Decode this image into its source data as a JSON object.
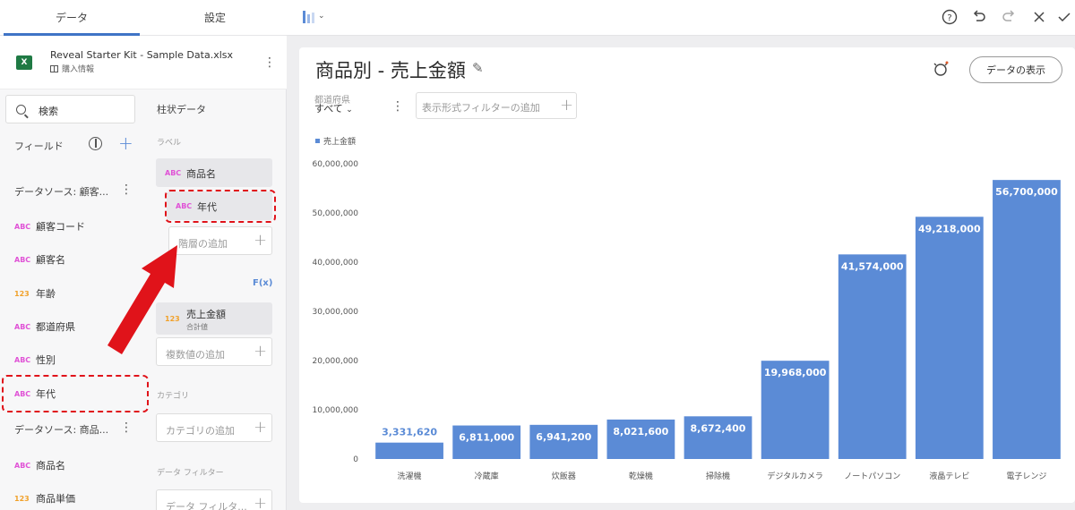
{
  "tabs": [
    "データ",
    "設定"
  ],
  "file": {
    "name": "Reveal Starter Kit - Sample Data.xlsx",
    "subtitle": "購入情報",
    "icon": "excel-icon"
  },
  "search": {
    "label": "検索"
  },
  "fields_title": "フィールド",
  "datasource1": {
    "title": "データソース: 顧客...",
    "fields": [
      {
        "type": "ABC",
        "name": "顧客コード"
      },
      {
        "type": "ABC",
        "name": "顧客名"
      },
      {
        "type": "123",
        "name": "年齢"
      },
      {
        "type": "ABC",
        "name": "都道府県"
      },
      {
        "type": "ABC",
        "name": "性別"
      },
      {
        "type": "ABC",
        "name": "年代"
      }
    ]
  },
  "datasource2": {
    "title": "データソース: 商品...",
    "fields": [
      {
        "type": "ABC",
        "name": "商品名"
      },
      {
        "type": "123",
        "name": "商品単価"
      }
    ]
  },
  "config": {
    "viz_type": "柱状データ",
    "label_section": "ラベル",
    "labels": [
      {
        "type": "ABC",
        "name": "商品名"
      },
      {
        "type": "ABC",
        "name": "年代"
      }
    ],
    "add_hierarchy": "階層の追加",
    "fx_label": "F(x)",
    "value_chip": {
      "type": "123",
      "name": "売上金額",
      "sub": "合計値"
    },
    "add_values": "複数値の追加",
    "category_section": "カテゴリ",
    "add_category": "カテゴリの追加",
    "data_filter_section": "データ フィルター",
    "add_data_filter": "データ フィルタ..."
  },
  "card": {
    "title": "商品別 - 売上金額",
    "view_data_button": "データの表示",
    "filter_label": "都道府県",
    "filter_value": "すべて",
    "filter_add_placeholder": "表示形式フィルターの追加"
  },
  "colors": {
    "bar": "#5b8bd6",
    "accent": "#3f74c6",
    "highlight": "#e0131a",
    "abc": "#e052d6",
    "num": "#f1a12a"
  },
  "chart_data": {
    "type": "bar",
    "categories": [
      "洗濯機",
      "冷蔵庫",
      "炊飯器",
      "乾燥機",
      "掃除機",
      "デジタルカメラ",
      "ノートパソコン",
      "液晶テレビ",
      "電子レンジ"
    ],
    "series": [
      {
        "name": "売上金額",
        "values": [
          3331620,
          6811000,
          6941200,
          8021600,
          8672400,
          19968000,
          41574000,
          49218000,
          56700000
        ]
      }
    ],
    "value_labels": [
      "3,331,620",
      "6,811,000",
      "6,941,200",
      "8,021,600",
      "8,672,400",
      "19,968,000",
      "41,574,000",
      "49,218,000",
      "56,700,000"
    ],
    "yticks": [
      "0",
      "10,000,000",
      "20,000,000",
      "30,000,000",
      "40,000,000",
      "50,000,000",
      "60,000,000"
    ],
    "ylim": [
      0,
      60000000
    ],
    "legend": "top-left",
    "grid": false
  }
}
